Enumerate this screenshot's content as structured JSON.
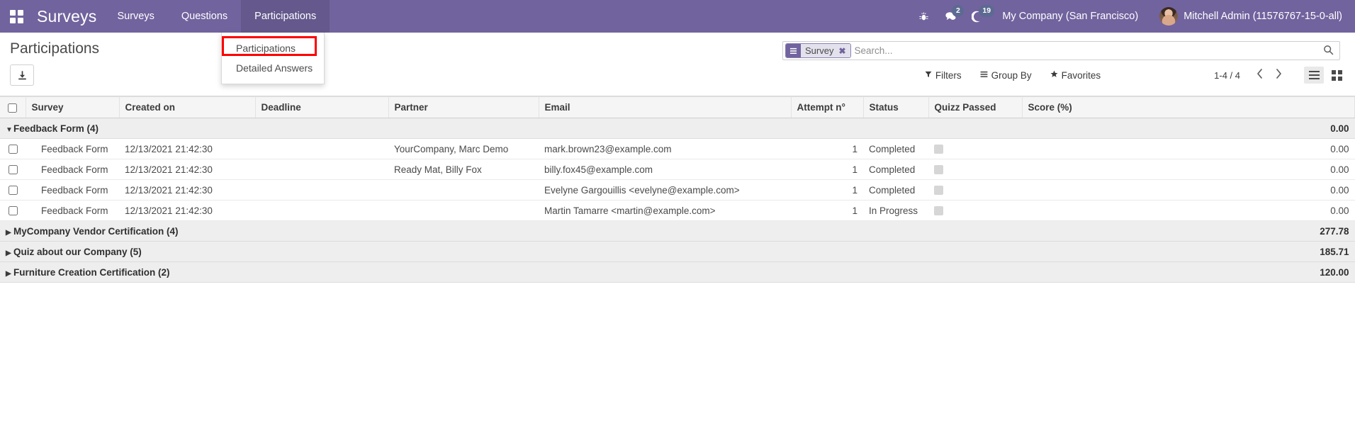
{
  "navbar": {
    "apps_icon": "grid-apps-icon",
    "brand": "Surveys",
    "menus": [
      {
        "label": "Surveys",
        "active": false
      },
      {
        "label": "Questions",
        "active": false
      },
      {
        "label": "Participations",
        "active": true
      }
    ],
    "sys_icons": [
      {
        "name": "bug-icon",
        "glyph": "🐞",
        "badge": ""
      },
      {
        "name": "messages-icon",
        "glyph": "💬",
        "badge": "2"
      },
      {
        "name": "activities-clock-icon",
        "glyph": "☾",
        "badge": "19"
      }
    ],
    "company": "My Company (San Francisco)",
    "user": "Mitchell Admin (11576767-15-0-all)"
  },
  "dropdown": {
    "items": [
      {
        "label": "Participations",
        "highlighted": true
      },
      {
        "label": "Detailed Answers",
        "highlighted": false
      }
    ],
    "highlight_color": "#ff0000"
  },
  "control_panel": {
    "title": "Participations",
    "export_icon": "download-icon",
    "search": {
      "facet_label": "Survey",
      "facet_icon": "group-lines-icon",
      "facet_close": "✖",
      "placeholder": "Search...",
      "value": "",
      "search_icon": "search-icon"
    },
    "buttons": [
      {
        "label": "Filters",
        "icon": "filter-funnel-icon"
      },
      {
        "label": "Group By",
        "icon": "group-lines-icon"
      },
      {
        "label": "Favorites",
        "icon": "star-icon"
      }
    ],
    "pager": {
      "range": "1-4 / 4",
      "prev_icon": "chevron-left-icon",
      "next_icon": "chevron-right-icon"
    },
    "views": [
      {
        "name": "list-view-button",
        "icon": "list-icon",
        "active": true
      },
      {
        "name": "kanban-view-button",
        "icon": "grid-icon",
        "active": false
      }
    ]
  },
  "table": {
    "columns": [
      "Survey",
      "Created on",
      "Deadline",
      "Partner",
      "Email",
      "Attempt n°",
      "Status",
      "Quizz Passed",
      "Score (%)"
    ],
    "groups": [
      {
        "label": "Feedback Form (4)",
        "expanded": true,
        "score": "0.00",
        "rows": [
          {
            "survey": "Feedback Form",
            "created_on": "12/13/2021 21:42:30",
            "deadline": "",
            "partner": "YourCompany, Marc Demo",
            "email": "mark.brown23@example.com",
            "attempt": "1",
            "status": "Completed",
            "quizz_passed": false,
            "score": "0.00"
          },
          {
            "survey": "Feedback Form",
            "created_on": "12/13/2021 21:42:30",
            "deadline": "",
            "partner": "Ready Mat, Billy Fox",
            "email": "billy.fox45@example.com",
            "attempt": "1",
            "status": "Completed",
            "quizz_passed": false,
            "score": "0.00"
          },
          {
            "survey": "Feedback Form",
            "created_on": "12/13/2021 21:42:30",
            "deadline": "",
            "partner": "",
            "email": "Evelyne Gargouillis <evelyne@example.com>",
            "attempt": "1",
            "status": "Completed",
            "quizz_passed": false,
            "score": "0.00"
          },
          {
            "survey": "Feedback Form",
            "created_on": "12/13/2021 21:42:30",
            "deadline": "",
            "partner": "",
            "email": "Martin Tamarre <martin@example.com>",
            "attempt": "1",
            "status": "In Progress",
            "quizz_passed": false,
            "score": "0.00"
          }
        ]
      },
      {
        "label": "MyCompany Vendor Certification (4)",
        "expanded": false,
        "score": "277.78",
        "rows": []
      },
      {
        "label": "Quiz about our Company (5)",
        "expanded": false,
        "score": "185.71",
        "rows": []
      },
      {
        "label": "Furniture Creation Certification (2)",
        "expanded": false,
        "score": "120.00",
        "rows": []
      }
    ]
  }
}
